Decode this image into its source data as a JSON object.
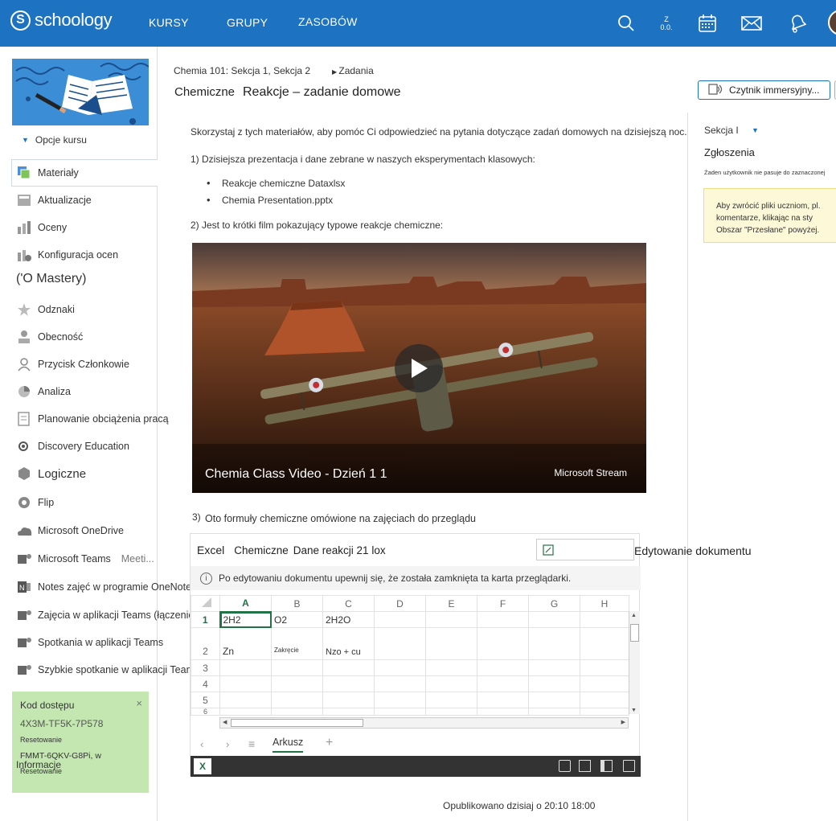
{
  "topbar": {
    "brand": "schoology",
    "brand_mark": "S",
    "nav": [
      "KURSY",
      "GRUPY",
      "ZASOBÓW"
    ],
    "notif_label_top": "Z",
    "notif_label_bottom": "0.0."
  },
  "sidebar": {
    "course_options": "Opcje kursu",
    "items": [
      {
        "label": "Materiały",
        "icon": "materials-icon"
      },
      {
        "label": "Aktualizacje",
        "icon": "updates-icon"
      },
      {
        "label": "Oceny",
        "icon": "grades-icon"
      },
      {
        "label": "Konfiguracja ocen",
        "icon": "grade-setup-icon"
      },
      {
        "label": "('O Mastery)",
        "icon": ""
      },
      {
        "label": "Odznaki",
        "icon": "badge-icon"
      },
      {
        "label": "Obecność",
        "icon": "attendance-icon"
      },
      {
        "label": "Przycisk Członkowie",
        "icon": "members-icon"
      },
      {
        "label": "Analiza",
        "icon": "analytics-icon"
      },
      {
        "label": "Planowanie obciążenia pracą",
        "icon": "workload-icon"
      },
      {
        "label": "Discovery Education",
        "icon": "discovery-icon"
      },
      {
        "label": "Logiczne",
        "icon": "logic-icon"
      },
      {
        "label": "Flip",
        "icon": "flip-icon"
      },
      {
        "label": "Microsoft OneDrive",
        "icon": "onedrive-icon"
      },
      {
        "label": "Microsoft Teams",
        "icon": "teams-icon",
        "extra": "Meeti..."
      },
      {
        "label": "Notes zajęć w programie OneNote",
        "icon": "onenote-icon"
      },
      {
        "label": "Zajęcia w aplikacji Teams (łączenie)",
        "icon": "teams-icon"
      },
      {
        "label": "Spotkania w aplikacji Teams",
        "icon": "teams-icon"
      },
      {
        "label": "Szybkie spotkanie w aplikacji Teams",
        "icon": "teams-icon"
      }
    ],
    "access": {
      "title": "Kod dostępu",
      "code1": "4X3M-TF5K-7P578",
      "reset1": "Resetowanie",
      "code2": "FMMT-6QKV-G8Pi, w",
      "reset2": "Resetowanie",
      "close": "×"
    },
    "info": "Informacje"
  },
  "header": {
    "breadcrumb": "Chemia 101: Sekcja 1, Sekcja 2",
    "breadcrumb_current": "Zadania",
    "title_prefix": "Chemiczne",
    "title": "Reakcje – zadanie domowe",
    "immersive_reader": "Czytnik immersyjny..."
  },
  "content": {
    "intro": "Skorzystaj z tych materiałów, aby pomóc Ci odpowiedzieć na pytania dotyczące zadań domowych na dzisiejszą noc.",
    "p1": "1) Dzisiejsza prezentacja i dane zebrane w naszych eksperymentach klasowych:",
    "files": [
      "Reakcje chemiczne Dataxlsx",
      "Chemia Presentation.pptx"
    ],
    "p2": "2) Jest to krótki film pokazujący typowe reakcje chemiczne:",
    "video": {
      "title": "Chemia Class Video - Dzień 1 1",
      "brand": "Microsoft Stream"
    },
    "p3_num": "3)",
    "p3": "Oto formuły chemiczne omówione na zajęciach do przeglądu",
    "published": "Opublikowano dzisiaj o 20:10 18:00"
  },
  "excel": {
    "app": "Excel",
    "doc_prefix": "Chemiczne",
    "doc_name": "Dane reakcji 21 lox",
    "edit_label": "Edytowanie dokumentu",
    "info": "Po edytowaniu dokumentu upewnij się, że została zamknięta ta karta przeglądarki.",
    "columns": [
      "A",
      "B",
      "C",
      "D",
      "E",
      "F",
      "G",
      "H"
    ],
    "rows": [
      {
        "n": "1",
        "cells": [
          "2H2",
          "O2",
          "2H2O",
          "",
          "",
          "",
          "",
          ""
        ]
      },
      {
        "n": "2",
        "cells": [
          "Zn",
          "Zakręcie",
          "Nzo + cu",
          "",
          "",
          "",
          "",
          ""
        ]
      },
      {
        "n": "3",
        "cells": [
          "",
          "",
          "",
          "",
          "",
          "",
          "",
          ""
        ]
      },
      {
        "n": "4",
        "cells": [
          "",
          "",
          "",
          "",
          "",
          "",
          "",
          ""
        ]
      },
      {
        "n": "5",
        "cells": [
          "",
          "",
          "",
          "",
          "",
          "",
          "",
          ""
        ]
      },
      {
        "n": "6",
        "cells": [
          "",
          "",
          "",
          "",
          "",
          "",
          "",
          ""
        ]
      }
    ],
    "sheet_tab": "Arkusz",
    "add_sheet": "+"
  },
  "right_panel": {
    "section": "Sekcja I",
    "submissions": "Zgłoszenia",
    "no_match": "Żaden użytkownik nie pasuje do zaznaczonej",
    "notice": "Aby zwrócić pliki uczniom, pl. komentarze, klikając na sty Obszar \"Przesłane\" powyżej."
  }
}
